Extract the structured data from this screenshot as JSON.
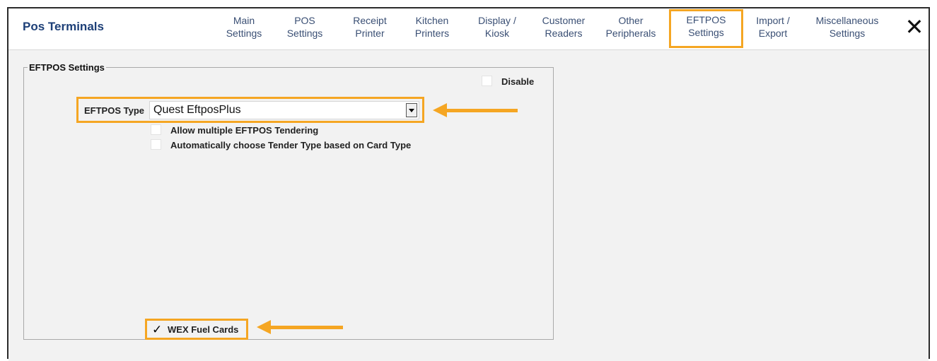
{
  "app": {
    "title": "Pos Terminals"
  },
  "tabs": [
    {
      "line1": "Main",
      "line2": "Settings"
    },
    {
      "line1": "POS",
      "line2": "Settings"
    },
    {
      "line1": "Receipt",
      "line2": "Printer"
    },
    {
      "line1": "Kitchen",
      "line2": "Printers"
    },
    {
      "line1": "Display /",
      "line2": "Kiosk"
    },
    {
      "line1": "Customer",
      "line2": "Readers"
    },
    {
      "line1": "Other",
      "line2": "Peripherals"
    },
    {
      "line1": "EFTPOS",
      "line2": "Settings"
    },
    {
      "line1": "Import /",
      "line2": "Export"
    },
    {
      "line1": "Miscellaneous",
      "line2": "Settings"
    }
  ],
  "active_tab": "EFTPOS Settings",
  "close_glyph": "✕",
  "eftpos": {
    "group_title": "EFTPOS Settings",
    "disable_label": "Disable",
    "disable_checked": false,
    "type_label": "EFTPOS Type",
    "type_value": "Quest EftposPlus",
    "allow_multiple_label": "Allow multiple EFTPOS Tendering",
    "allow_multiple_checked": false,
    "auto_tender_label": "Automatically choose Tender Type based on Card Type",
    "auto_tender_checked": false,
    "wex_label": "WEX Fuel Cards",
    "wex_checked": true,
    "check_glyph": "✓"
  },
  "colors": {
    "accent": "#f5a623",
    "title": "#1d3f77",
    "tab_text": "#3a4f74"
  }
}
